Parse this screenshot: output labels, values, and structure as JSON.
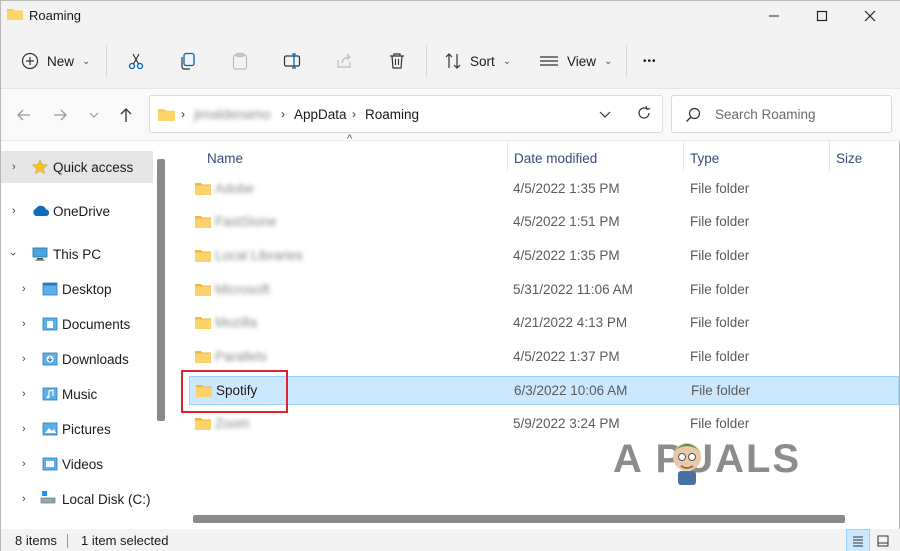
{
  "window": {
    "title": "Roaming",
    "controls": {
      "minimize": "—",
      "maximize": "☐",
      "close": "✕"
    }
  },
  "toolbar": {
    "new_label": "New",
    "sort_label": "Sort",
    "view_label": "View",
    "more_label": "•••"
  },
  "address": {
    "crumbs": [
      "jimaldenamo",
      "AppData",
      "Roaming"
    ],
    "search_placeholder": "Search Roaming"
  },
  "nav": {
    "quick_access": "Quick access",
    "onedrive": "OneDrive",
    "this_pc": "This PC",
    "items": [
      "Desktop",
      "Documents",
      "Downloads",
      "Music",
      "Pictures",
      "Videos",
      "Local Disk (C:)"
    ]
  },
  "columns": {
    "name": "Name",
    "date": "Date modified",
    "type": "Type",
    "size": "Size"
  },
  "files": [
    {
      "name": "Adobe",
      "date": "4/5/2022 1:35 PM",
      "type": "File folder",
      "blurred": true
    },
    {
      "name": "FastStone",
      "date": "4/5/2022 1:51 PM",
      "type": "File folder",
      "blurred": true
    },
    {
      "name": "Local Libraries",
      "date": "4/5/2022 1:35 PM",
      "type": "File folder",
      "blurred": true
    },
    {
      "name": "Microsoft",
      "date": "5/31/2022 11:06 AM",
      "type": "File folder",
      "blurred": true
    },
    {
      "name": "Mozilla",
      "date": "4/21/2022 4:13 PM",
      "type": "File folder",
      "blurred": true
    },
    {
      "name": "Parallels",
      "date": "4/5/2022 1:37 PM",
      "type": "File folder",
      "blurred": true
    },
    {
      "name": "Spotify",
      "date": "6/3/2022 10:06 AM",
      "type": "File folder",
      "blurred": false
    },
    {
      "name": "Zoom",
      "date": "5/9/2022 3:24 PM",
      "type": "File folder",
      "blurred": true
    }
  ],
  "status": {
    "item_count": "8 items",
    "selection": "1 item selected"
  },
  "watermark": {
    "text": "A PUALS"
  },
  "colors": {
    "folder": "#f8c94a",
    "selection": "#cce8ff",
    "highlight": "#e0242f",
    "accent": "#0067c0"
  }
}
